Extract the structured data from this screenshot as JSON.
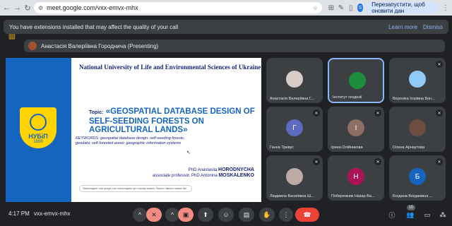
{
  "browser": {
    "url": "meet.google.com/vxx-emvx-mhx",
    "profile_initial": "S",
    "relaunch_label": "Перезапустити, щоб оновити дан"
  },
  "infobar": {
    "message": "You have extensions installed that may affect the quality of your call",
    "learn_more": "Learn more",
    "dismiss": "Dismiss"
  },
  "presenting": {
    "label": "Анастасія Валеріївна Городнича (Presenting)"
  },
  "slide": {
    "university": "National University of Life and Environmental Sciences of Ukraine",
    "logo_name": "НУБіП",
    "logo_year": "1898",
    "topic_prefix": "Topic:",
    "topic": "«GEOSPATIAL DATABASE DESIGN OF SELF-SEEDING FORESTS ON AGRICULTURAL LANDS»",
    "keywords": "KEYWORDS: geospatial database design; self-seeding forests; geodata; self-forested areas; geographic information systems",
    "author1_title": "PhD",
    "author1_name": "Anastasiia",
    "author1_surname": "HORODNYCHA",
    "author2_title": "associate professor, PhD",
    "author2_name": "Antonina",
    "author2_surname": "MOSKALENKO",
    "translate_bar": "Перекладати този google.com перекладати цю сторінку мовою, Перекл  Змінить мовою  Ще"
  },
  "participants": [
    {
      "name": "Анастасія Валеріївна Г...",
      "initial": "",
      "color": "#d7ccc8",
      "muted": false
    },
    {
      "name": "Інститут геодезії",
      "initial": "",
      "color": "#1e8e3e",
      "muted": false
    },
    {
      "name": "Вероніка Ігорівна Бон...",
      "initial": "",
      "color": "#90caf9",
      "muted": true
    },
    {
      "name": "Ганна Тривус",
      "initial": "Г",
      "color": "#5c6bc0",
      "muted": true
    },
    {
      "name": "Ірина Олійникова",
      "initial": "І",
      "color": "#8d6e63",
      "muted": true
    },
    {
      "name": "Олена Арнаутова",
      "initial": "",
      "color": "#6d4c41",
      "muted": true
    },
    {
      "name": "Людмила Василівна Ш...",
      "initial": "",
      "color": "#bcaaa4",
      "muted": true
    },
    {
      "name": "Побережник Назар Ва...",
      "initial": "Н",
      "color": "#ad1457",
      "muted": true
    },
    {
      "name": "Богдана Богданівна ...",
      "initial": "Б",
      "color": "#1565c0",
      "muted": true
    }
  ],
  "bottom": {
    "time": "4:17 PM",
    "meeting_code": "vxx-emvx-mhx",
    "people_count": "10"
  }
}
